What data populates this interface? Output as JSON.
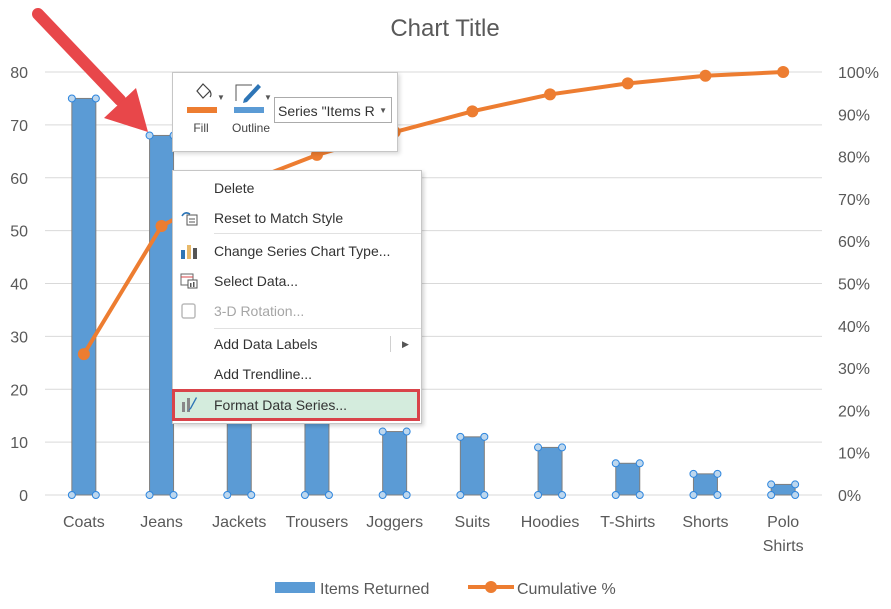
{
  "chart_data": {
    "type": "bar",
    "title": "Chart Title",
    "categories": [
      "Coats",
      "Jeans",
      "Jackets",
      "Trousers",
      "Joggers",
      "Suits",
      "Hoodies",
      "T-Shirts",
      "Shorts",
      "Polo Shirts"
    ],
    "series": [
      {
        "name": "Items Returned",
        "type": "bar",
        "axis": "left",
        "color": "#5b9bd5",
        "values": [
          75,
          68,
          22,
          16,
          12,
          11,
          9,
          6,
          4,
          2
        ]
      },
      {
        "name": "Cumulative %",
        "type": "line",
        "axis": "right",
        "color": "#ed7d31",
        "values": [
          33.3,
          63.6,
          73.3,
          80.4,
          85.8,
          90.7,
          94.7,
          97.3,
          99.1,
          100
        ]
      }
    ],
    "y_left": {
      "min": 0,
      "max": 80,
      "step": 10,
      "ticks": [
        "0",
        "10",
        "20",
        "30",
        "40",
        "50",
        "60",
        "70",
        "80"
      ]
    },
    "y_right": {
      "min": 0,
      "max": 100,
      "step": 10,
      "ticks": [
        "0%",
        "10%",
        "20%",
        "30%",
        "40%",
        "50%",
        "60%",
        "70%",
        "80%",
        "90%",
        "100%"
      ]
    },
    "grid": true,
    "legend": "bottom",
    "selected_series": "Items Returned"
  },
  "annotation": {
    "arrow_color": "#e8474a",
    "highlight_color": "#d9444a"
  },
  "mini_toolbar": {
    "fill_label": "Fill",
    "fill_color": "#ed7d31",
    "outline_label": "Outline",
    "outline_color": "#5b9bd5",
    "series_select_value": "Series \"Items R"
  },
  "context_menu": {
    "items": [
      {
        "label": "Delete",
        "icon": "none",
        "enabled": true
      },
      {
        "label": "Reset to Match Style",
        "icon": "reset-style-icon",
        "enabled": true
      },
      {
        "label": "Change Series Chart Type...",
        "icon": "chart-type-icon",
        "enabled": true
      },
      {
        "label": "Select Data...",
        "icon": "select-data-icon",
        "enabled": true
      },
      {
        "label": "3-D Rotation...",
        "icon": "3d-rotation-icon",
        "enabled": false
      },
      {
        "label": "Add Data Labels",
        "icon": "none",
        "enabled": true,
        "submenu": true
      },
      {
        "label": "Add Trendline...",
        "icon": "none",
        "enabled": true
      },
      {
        "label": "Format Data Series...",
        "icon": "format-series-icon",
        "enabled": true,
        "highlighted": true
      }
    ]
  }
}
